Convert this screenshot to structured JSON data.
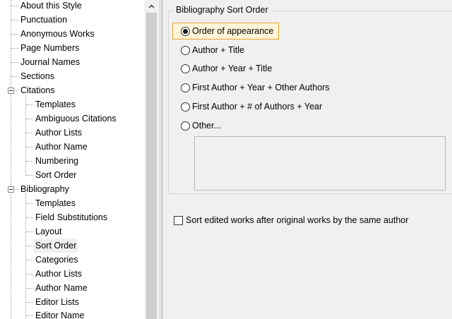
{
  "tree": {
    "items": [
      {
        "label": "About this Style",
        "level": 1
      },
      {
        "label": "Punctuation",
        "level": 1
      },
      {
        "label": "Anonymous Works",
        "level": 1
      },
      {
        "label": "Page Numbers",
        "level": 1
      },
      {
        "label": "Journal Names",
        "level": 1
      },
      {
        "label": "Sections",
        "level": 1
      },
      {
        "label": "Citations",
        "level": 1,
        "expanded": true
      },
      {
        "label": "Templates",
        "level": 2
      },
      {
        "label": "Ambiguous Citations",
        "level": 2
      },
      {
        "label": "Author Lists",
        "level": 2
      },
      {
        "label": "Author Name",
        "level": 2
      },
      {
        "label": "Numbering",
        "level": 2
      },
      {
        "label": "Sort Order",
        "level": 2
      },
      {
        "label": "Bibliography",
        "level": 1,
        "expanded": true
      },
      {
        "label": "Templates",
        "level": 2
      },
      {
        "label": "Field Substitutions",
        "level": 2
      },
      {
        "label": "Layout",
        "level": 2
      },
      {
        "label": "Sort Order",
        "level": 2,
        "selected": true
      },
      {
        "label": "Categories",
        "level": 2
      },
      {
        "label": "Author Lists",
        "level": 2
      },
      {
        "label": "Author Name",
        "level": 2
      },
      {
        "label": "Editor Lists",
        "level": 2
      },
      {
        "label": "Editor Name",
        "level": 2
      }
    ]
  },
  "sort_order": {
    "title": "Bibliography Sort Order",
    "options": [
      {
        "label": "Order of appearance",
        "checked": true
      },
      {
        "label": "Author + Title",
        "checked": false
      },
      {
        "label": "Author + Year + Title",
        "checked": false
      },
      {
        "label": "First Author + Year + Other Authors",
        "checked": false
      },
      {
        "label": "First Author + # of Authors + Year",
        "checked": false
      },
      {
        "label": "Other...",
        "checked": false
      }
    ],
    "other_value": ""
  },
  "sort_edited": {
    "label": "Sort edited works after original works by the same author",
    "checked": false
  }
}
